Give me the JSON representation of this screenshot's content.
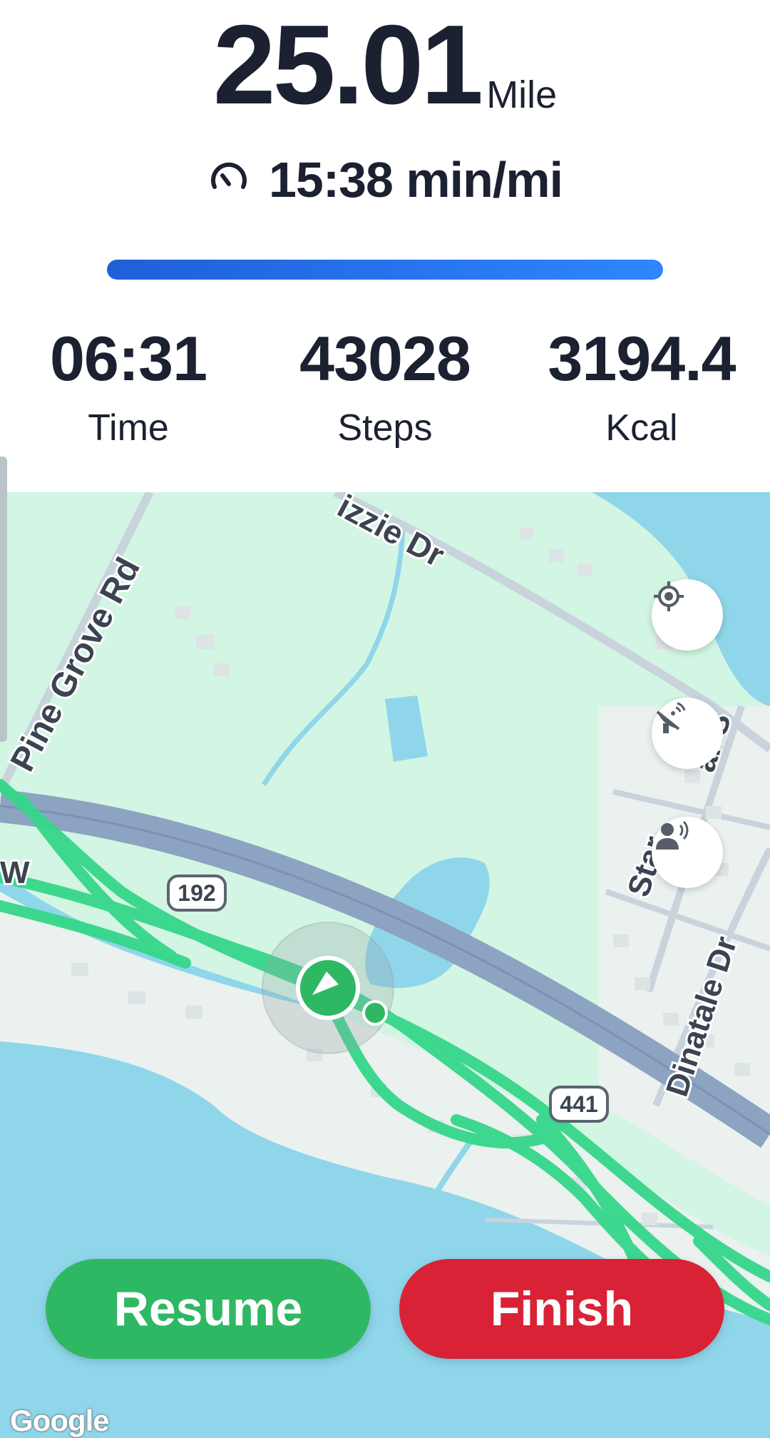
{
  "workout": {
    "distance_value": "25.01",
    "distance_unit": "Mile",
    "pace": "15:38 min/mi",
    "progress_fraction": 1.0
  },
  "metrics": [
    {
      "value": "06:31",
      "label": "Time"
    },
    {
      "value": "43028",
      "label": "Steps"
    },
    {
      "value": "3194.4",
      "label": "Kcal"
    }
  ],
  "map": {
    "road_labels": {
      "pine_grove": "Pine Grove Rd",
      "lizzie": "izzie Dr",
      "stargazer": "Star",
      "stargazer_tail": "ar S",
      "dinatale": "Dinatale Dr",
      "w": "W"
    },
    "highway_shields": [
      "192",
      "441"
    ],
    "attribution": "Google",
    "colors": {
      "land": "#d3f5e3",
      "water": "#8fd6ea",
      "highway": "#8ca3c2",
      "route": "#35d68a"
    }
  },
  "icons": {
    "pace": "speedometer-icon",
    "locate": "my-location-icon",
    "satellite": "satellite-dish-icon",
    "voice": "voice-coach-icon",
    "position": "navigation-arrow-icon"
  },
  "actions": {
    "resume_label": "Resume",
    "finish_label": "Finish"
  },
  "colors": {
    "resume": "#2fb863",
    "finish": "#da2236",
    "progress": "#2f86ff"
  }
}
